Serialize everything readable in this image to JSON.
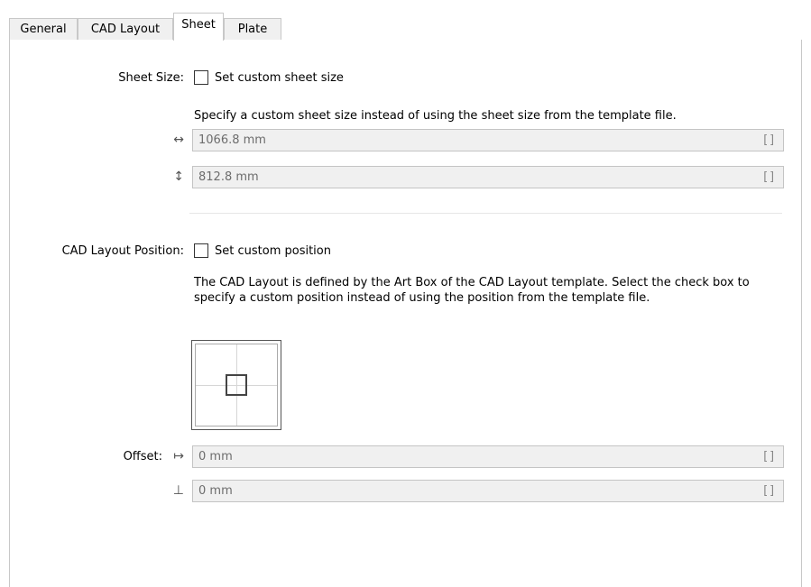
{
  "tabs": [
    {
      "label": "General",
      "active": false
    },
    {
      "label": "CAD Layout",
      "active": false
    },
    {
      "label": "Sheet",
      "active": true
    },
    {
      "label": "Plate",
      "active": false
    }
  ],
  "sheet_size": {
    "label": "Sheet Size:",
    "checkbox_label": "Set custom sheet size",
    "checked": false,
    "description": "Specify a custom sheet size instead of using the sheet size from the template file.",
    "width_icon": "horizontal-arrow-icon",
    "width_value": "1066.8 mm",
    "height_icon": "vertical-arrow-icon",
    "height_value": "812.8 mm",
    "field_button": "[]"
  },
  "cad_layout_position": {
    "label": "CAD Layout Position:",
    "checkbox_label": "Set custom position",
    "checked": false,
    "description": "The CAD Layout is defined by the Art Box of the CAD Layout template. Select the check box to specify a custom position instead of using the position from the template file.",
    "offset_label": "Offset:",
    "offset_x_icon": "horizontal-offset-icon",
    "offset_x_value": "0 mm",
    "offset_y_icon": "vertical-offset-icon",
    "offset_y_value": "0 mm",
    "field_button": "[]"
  },
  "colors": {
    "field_background": "#f0f0f0",
    "field_text": "#6d6d6d",
    "border": "#c8c8c8"
  }
}
